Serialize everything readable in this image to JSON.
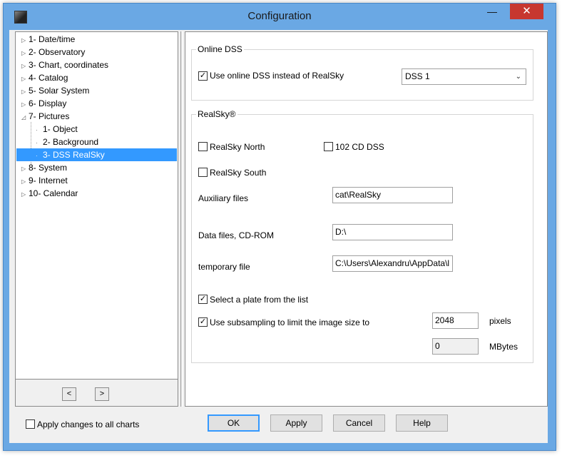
{
  "window": {
    "title": "Configuration",
    "minimize_glyph": "—",
    "close_glyph": "✕"
  },
  "tree": {
    "items": [
      {
        "label": "1- Date/time"
      },
      {
        "label": "2- Observatory"
      },
      {
        "label": "3- Chart, coordinates"
      },
      {
        "label": "4- Catalog"
      },
      {
        "label": "5- Solar System"
      },
      {
        "label": "6- Display"
      },
      {
        "label": "7- Pictures"
      },
      {
        "label": "1- Object"
      },
      {
        "label": "2- Background"
      },
      {
        "label": "3- DSS RealSky"
      },
      {
        "label": "8- System"
      },
      {
        "label": "9- Internet"
      },
      {
        "label": "10- Calendar"
      }
    ],
    "prev_label": "<",
    "next_label": ">"
  },
  "online_dss": {
    "group_label": "Online DSS",
    "use_online_label": "Use online DSS instead of RealSky",
    "use_online_checked": true,
    "source_value": "DSS 1"
  },
  "realsky": {
    "group_label": "RealSky®",
    "north_label": "RealSky North",
    "north_checked": false,
    "cd102_label": "102 CD DSS",
    "cd102_checked": false,
    "south_label": "RealSky South",
    "south_checked": false,
    "aux_label": "Auxiliary files",
    "aux_value": "cat\\RealSky",
    "data_label": "Data files, CD-ROM",
    "data_value": "D:\\",
    "temp_label": "temporary file",
    "temp_value": "C:\\Users\\Alexandru\\AppData\\l",
    "plate_label": "Select a plate from the list",
    "plate_checked": true,
    "subsample_label": "Use subsampling to limit the image size to",
    "subsample_checked": true,
    "pixels_value": "2048",
    "pixels_unit": "pixels",
    "mbytes_value": "0",
    "mbytes_unit": "MBytes"
  },
  "footer": {
    "apply_all_label": "Apply changes to all charts",
    "apply_all_checked": false,
    "ok_label": "OK",
    "apply_label": "Apply",
    "cancel_label": "Cancel",
    "help_label": "Help"
  },
  "icons": {
    "checkmark": "check-icon",
    "expander": "triangle-expander-icon",
    "dropdown": "chevron-down-icon"
  },
  "colors": {
    "selection": "#3399ff",
    "title_bar": "#6aa8e4",
    "close_button": "#c7372f"
  }
}
